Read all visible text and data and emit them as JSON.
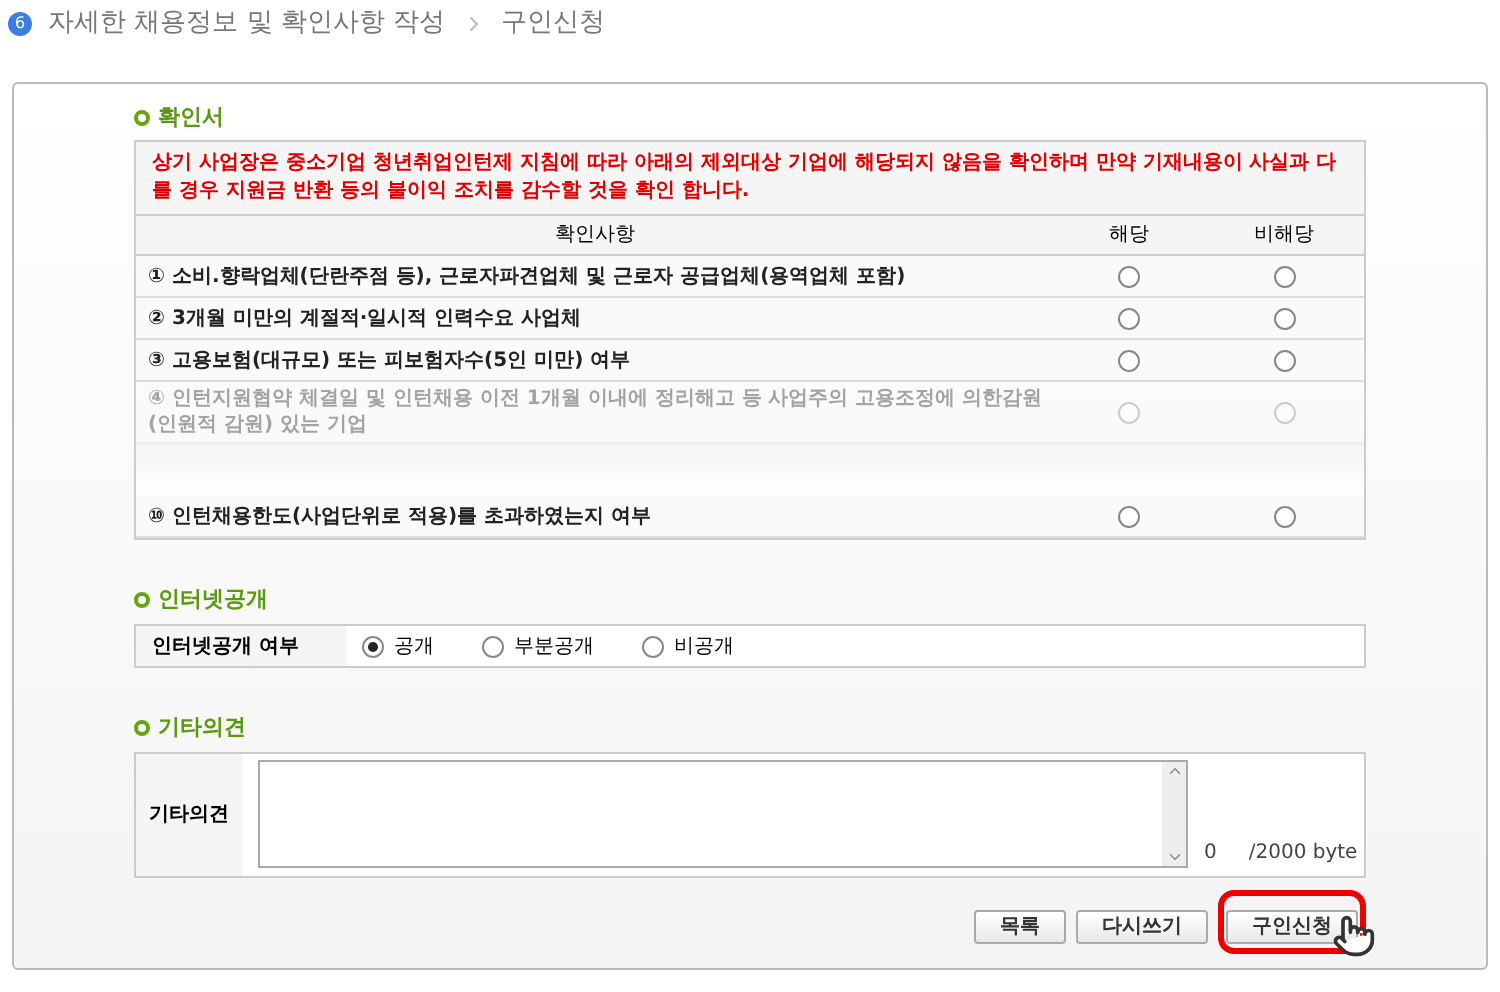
{
  "breadcrumb": {
    "step": "6",
    "items": [
      "자세한 채용정보 및 확인사항 작성",
      "구인신청"
    ]
  },
  "confirmation": {
    "heading": "확인서",
    "notice": "상기 사업장은 중소기업 청년취업인턴제 지침에 따라 아래의 제외대상 기업에 해당되지 않음을 확인하며 만약 기재내용이 사실과 다를 경우 지원금 반환 등의 불이익 조치를 감수할 것을 확인 합니다.",
    "columns": [
      "확인사항",
      "해당",
      "비해당"
    ],
    "rows": [
      {
        "number": "①",
        "text": "소비.향락업체(단란주점 등), 근로자파견업체 및 근로자 공급업체(용역업체 포함)",
        "faded": false,
        "applies": false,
        "not_applies": false
      },
      {
        "number": "②",
        "text": "3개월 미만의 계절적·일시적 인력수요 사업체",
        "faded": false,
        "applies": false,
        "not_applies": false
      },
      {
        "number": "③",
        "text": "고용보험(대규모) 또는 피보험자수(5인 미만) 여부",
        "faded": false,
        "applies": false,
        "not_applies": false
      },
      {
        "number": "④",
        "text": "인턴지원협약 체결일 및 인턴채용 이전 1개월 이내에 정리해고 등 사업주의 고용조정에 의한감원(인원적 감원) 있는 기업",
        "faded": true,
        "applies": false,
        "not_applies": false
      },
      {
        "number": "⑩",
        "text": "인턴채용한도(사업단위로 적용)를 초과하였는지 여부",
        "faded": false,
        "applies": false,
        "not_applies": false
      }
    ]
  },
  "internet": {
    "heading": "인터넷공개",
    "label": "인터넷공개 여부",
    "options": [
      {
        "label": "공개",
        "selected": true
      },
      {
        "label": "부분공개",
        "selected": false
      },
      {
        "label": "비공개",
        "selected": false
      }
    ]
  },
  "opinion": {
    "heading": "기타의견",
    "label": "기타의견",
    "count": "0",
    "limit": "/2000 byte"
  },
  "buttons": [
    {
      "label": "목록",
      "highlighted": false
    },
    {
      "label": "다시쓰기",
      "highlighted": false
    },
    {
      "label": "구인신청",
      "highlighted": true
    }
  ]
}
